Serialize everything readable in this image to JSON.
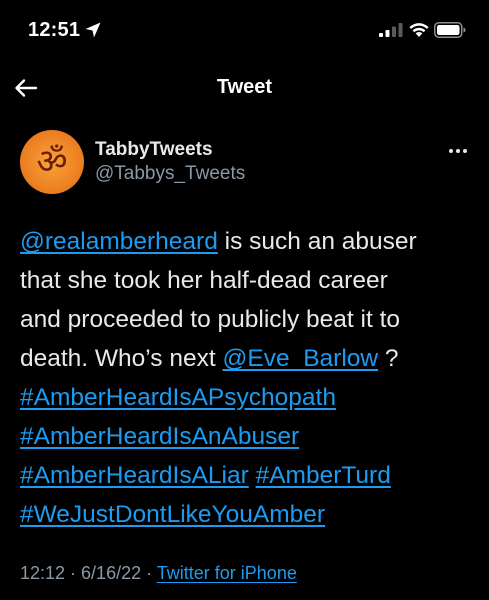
{
  "status_bar": {
    "time": "12:51"
  },
  "nav": {
    "title": "Tweet"
  },
  "author": {
    "display_name": "TabbyTweets",
    "username": "@Tabbys_Tweets",
    "avatar_glyph": "ॐ"
  },
  "tweet": {
    "line1": {
      "mention": "@realamberheard",
      "text": " is such an abuser"
    },
    "line2": "that she took her half-dead career",
    "line3": "and proceeded to publicly beat it to",
    "line4": {
      "text_before": "death.  Who’s next ",
      "mention": "@Eve_Barlow",
      "text_after": " ?"
    },
    "hashtags": [
      "#AmberHeardIsAPsychopath",
      "#AmberHeardIsAnAbuser",
      "#AmberHeardIsALiar",
      "#AmberTurd",
      "#WeJustDontLikeYouAmber"
    ]
  },
  "meta": {
    "time": "12:12",
    "separator1": " · ",
    "date": "6/16/22",
    "separator2": " · ",
    "source": "Twitter for iPhone"
  },
  "colors": {
    "background": "#000000",
    "text": "#e7e9ea",
    "secondary_text": "#8b98a5",
    "link": "#1d9bf0"
  },
  "icons": [
    "location-arrow-icon",
    "cellular-signal-icon",
    "wifi-icon",
    "battery-icon",
    "back-arrow-icon",
    "more-options-icon"
  ]
}
